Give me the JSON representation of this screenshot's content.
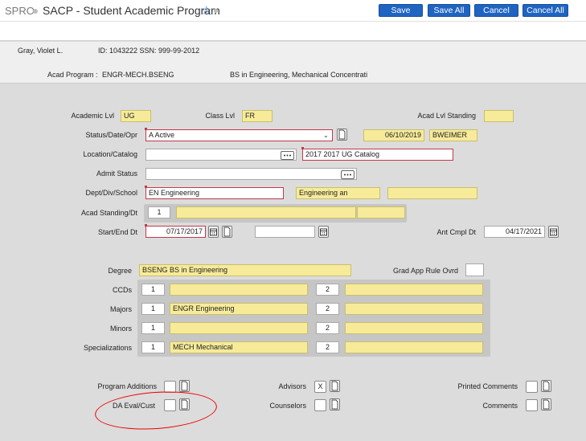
{
  "header": {
    "app_code": "SPRO",
    "title": "SACP - Student Academic Program",
    "buttons": {
      "save": "Save",
      "save_all": "Save All",
      "cancel": "Cancel",
      "cancel_all": "Cancel All"
    }
  },
  "student": {
    "name": "Gray,  Violet L.",
    "id_line": "ID: 1043222 SSN: 999-99-2012",
    "acad_program_label": "Acad Program :",
    "acad_program_code": "ENGR-MECH.BSENG",
    "acad_program_desc": "BS in Engineering, Mechanical Concentrati"
  },
  "form": {
    "academic_lvl": {
      "label": "Academic Lvl",
      "value": "UG"
    },
    "class_lvl": {
      "label": "Class Lvl",
      "value": "FR"
    },
    "acad_lvl_standing": {
      "label": "Acad Lvl Standing",
      "value": ""
    },
    "status_date_opr": {
      "label": "Status/Date/Opr",
      "status": "A Active",
      "date": "06/10/2019",
      "opr": "BWEIMER"
    },
    "location_catalog": {
      "label": "Location/Catalog",
      "location": "",
      "catalog": "2017 2017 UG Catalog"
    },
    "admit_status": {
      "label": "Admit Status",
      "value": ""
    },
    "dept_div_school": {
      "label": "Dept/Div/School",
      "dept": "EN Engineering",
      "div": "Engineering an",
      "school": ""
    },
    "acad_standing_dt": {
      "label": "Acad Standing/Dt",
      "row": "1",
      "standing": "",
      "date": ""
    },
    "start_end_dt": {
      "label": "Start/End Dt",
      "start": "07/17/2017",
      "end": ""
    },
    "ant_cmpl_dt": {
      "label": "Ant Cmpl Dt",
      "value": "04/17/2021"
    },
    "degree": {
      "label": "Degree",
      "value": "BSENG BS in Engineering"
    },
    "grad_app_rule_ovrd": {
      "label": "Grad App Rule Ovrd",
      "value": ""
    },
    "ccds": {
      "label": "CCDs",
      "row1": "1",
      "val1": "",
      "row2": "2",
      "val2": ""
    },
    "majors": {
      "label": "Majors",
      "row1": "1",
      "val1": "ENGR Engineering",
      "row2": "2",
      "val2": ""
    },
    "minors": {
      "label": "Minors",
      "row1": "1",
      "val1": "",
      "row2": "2",
      "val2": ""
    },
    "specializations": {
      "label": "Specializations",
      "row1": "1",
      "val1": "MECH Mechanical",
      "row2": "2",
      "val2": ""
    },
    "program_additions": {
      "label": "Program Additions",
      "value": ""
    },
    "da_eval_cust": {
      "label": "DA Eval/Cust",
      "value": ""
    },
    "advisors": {
      "label": "Advisors",
      "value": "X"
    },
    "counselors": {
      "label": "Counselors",
      "value": ""
    },
    "printed_comments": {
      "label": "Printed Comments",
      "value": ""
    },
    "comments": {
      "label": "Comments",
      "value": ""
    }
  },
  "colors": {
    "accent": "#1f64c1",
    "readonly_fill": "#f7eb9a",
    "required_border": "#c0394b",
    "annotation": "#ee0000"
  }
}
